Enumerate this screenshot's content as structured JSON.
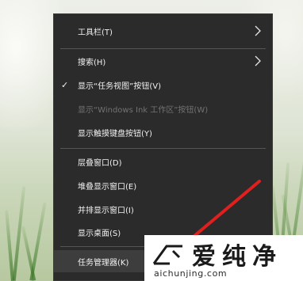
{
  "context_menu": {
    "items": [
      {
        "label": "工具栏(T)",
        "has_submenu": true
      },
      {
        "label": "搜索(H)",
        "has_submenu": true
      },
      {
        "label": "显示“任务视图”按钮(V)",
        "checked": true
      },
      {
        "label": "显示“Windows Ink 工作区”按钮(W)",
        "disabled": true
      },
      {
        "label": "显示触摸键盘按钮(Y)"
      },
      {
        "label": "层叠窗口(D)"
      },
      {
        "label": "堆叠显示窗口(E)"
      },
      {
        "label": "并排显示窗口(I)"
      },
      {
        "label": "显示桌面(S)"
      },
      {
        "label": "任务管理器(K)",
        "highlighted": true
      }
    ],
    "check_glyph": "✓",
    "submenu_icon": "chevron-right-icon"
  },
  "annotation": {
    "color": "#e0201f",
    "icon": "red-arrow-pointer"
  },
  "watermark": {
    "title": "爱纯净",
    "url": "aichunjing.com",
    "logo_icon": "brand-logo-icon"
  }
}
